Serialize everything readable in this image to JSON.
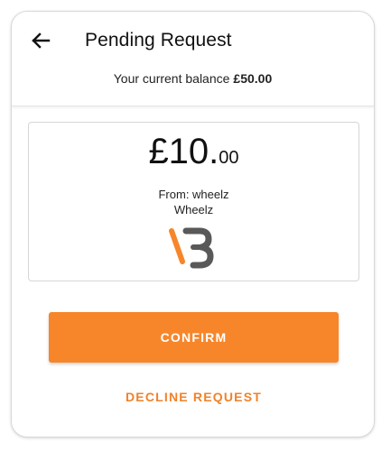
{
  "header": {
    "title": "Pending Request",
    "back_icon": "arrow-left-icon",
    "balance_label": "Your current balance",
    "balance_value": "£50.00"
  },
  "request": {
    "amount_major": "£10.",
    "amount_minor": "00",
    "from_label": "From: wheelz",
    "name": "Wheelz",
    "logo_icon": "wheelz-logo"
  },
  "actions": {
    "confirm_label": "CONFIRM",
    "decline_label": "DECLINE REQUEST"
  },
  "colors": {
    "accent": "#f7862a",
    "logo_gray": "#595959"
  }
}
